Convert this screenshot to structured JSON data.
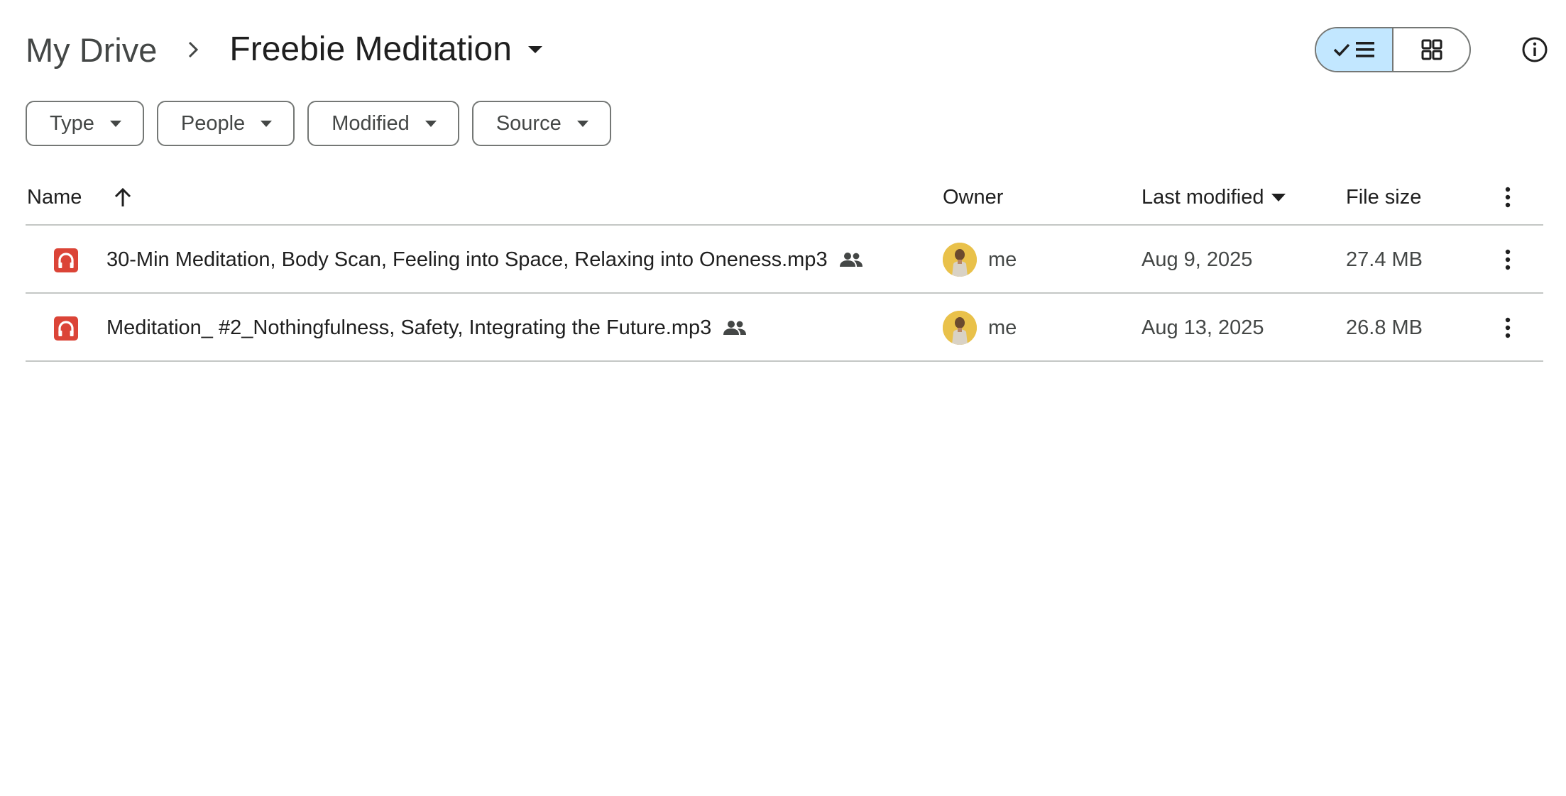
{
  "breadcrumb": {
    "root": "My Drive",
    "current": "Freebie Meditation"
  },
  "view_toggle": {
    "active": "list",
    "options": [
      "list-icon",
      "grid-icon"
    ]
  },
  "filters": [
    {
      "label": "Type"
    },
    {
      "label": "People"
    },
    {
      "label": "Modified"
    },
    {
      "label": "Source"
    }
  ],
  "table": {
    "columns": {
      "name": "Name",
      "owner": "Owner",
      "last_modified": "Last modified",
      "file_size": "File size"
    },
    "rows": [
      {
        "name": "30-Min Meditation, Body Scan, Feeling into Space, Relaxing into Oneness.mp3",
        "shared": true,
        "owner": "me",
        "last_modified": "Aug 9, 2025",
        "file_size": "27.4 MB"
      },
      {
        "name": "Meditation_ #2_Nothingfulness, Safety, Integrating the Future.mp3",
        "shared": true,
        "owner": "me",
        "last_modified": "Aug 13, 2025",
        "file_size": "26.8 MB"
      }
    ]
  },
  "colors": {
    "audio_icon": "#db4437",
    "toggle_active_bg": "#c2e7ff",
    "border": "#747775",
    "divider": "#c4c7c5",
    "avatar_bg": "#e9c14a"
  }
}
